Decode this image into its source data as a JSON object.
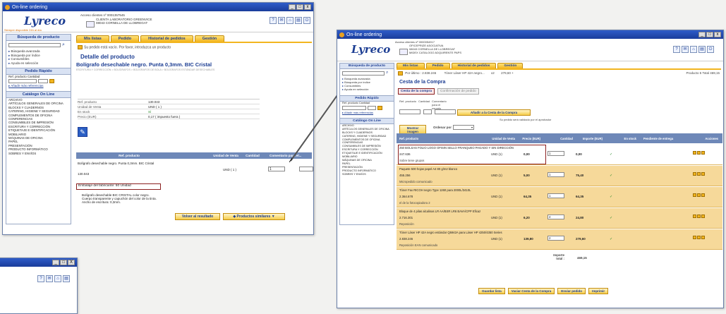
{
  "window1": {
    "title": "On-line ordering",
    "logo": "Lyreco",
    "logo_sub": "Siempre disponible 24h al día",
    "client": [
      "Acceso clientes nº 0001357545",
      "CLIENTA LABORATORIO GREENVICE",
      "08043 CORNELLA DE LLOBREGAT"
    ],
    "tabs": [
      "Mis listas",
      "Pedido",
      "Historial de pedidos",
      "Gestión"
    ],
    "empty_msg": "Su pedido está vacío. Por favor, introduzca un producto",
    "section_title": "Detalle del producto",
    "product_title": "Bolígrafo desechable negro. Punta 0,3mm. BIC Cristal",
    "breadcrumb": "ESCRITURA Y CORRECCIÓN > BOLÍGRAFOS > BOLÍGRAFOS DE BOLA > BOLÍGRAFOS ESTÁNDAR DESECHABLES",
    "details": [
      {
        "k": "Ref. producto",
        "v": "130.043"
      },
      {
        "k": "Unidad de Venta",
        "v": "UND ( 1 )"
      },
      {
        "k": "En stock",
        "v": "Sí"
      },
      {
        "k": "Precio (EUR)",
        "v": "0,17 ( impuesto fuera )"
      }
    ],
    "table_headers": [
      "Ref. producto",
      "Unidad de Venta",
      "Cantidad",
      "Comentario para el..."
    ],
    "row_desc": "Bolígrafo desechable negro. Punta 0,3mm. BIC Cristal",
    "row_ref": "130.043",
    "row_unit": "UND ( 1 )",
    "row_qty": "1",
    "packing": "Embalaje del fabricante: 50 Unidad",
    "long_desc": [
      "Bolígrafo desechable BIC CRISTAL color negro.",
      "Cuerpo transparente y capuchón del color de la tinta.",
      "Ancho de escritura: 0,3mm."
    ],
    "btn_back": "Volver al resultado",
    "btn_similar": "Productos similares",
    "sidebar": {
      "search_title": "Búsqueda de producto",
      "links": [
        "Búsqueda avanzada",
        "Búsqueda por índice",
        "Consumibles",
        "Ayuda en selección"
      ],
      "quick_title": "Pedido Rápido",
      "quick_label": "Ref. producto Cantidad",
      "more_refs": "Añadir más referencias",
      "catalog_title": "Catálogo On Line",
      "catalog": [
        "ARCHIVO",
        "ARTÍCULOS GENERALES DE OFICINA",
        "BLOCKS Y CUADERNOS",
        "CATERING, HIGIENE Y SEGURIDAD",
        "COMPLEMENTOS DE OFICINA",
        "CONFERENCIAS",
        "CONSUMIBLES DE IMPRESIÓN",
        "ESCRITURA Y CORRECCIÓN",
        "ETIQUETAJE E IDENTIFICACIÓN",
        "MOBILIARIO",
        "MÁQUINAS DE OFICINA",
        "PAPEL",
        "PRESENTACIÓN",
        "PRODUCTO INFORMÁTICO",
        "SOBRES Y ENVÍOS"
      ]
    }
  },
  "window2": {
    "title": "On-line ordering",
    "logo": "Lyreco",
    "client": [
      "Acceso clientes nº 0000054917",
      "OFICEPRIZE ASOCIATIVA",
      "08043 CORNELLA DE LLOBREGAT",
      "MIDEX CATALOGO ADQUIRENTE PAPS"
    ],
    "tabs": [
      "Mis listas",
      "Pedido",
      "Historial de pedidos",
      "Gestión"
    ],
    "last_added": "Por último : 2.838.246",
    "last_item": "Tóner Láser HP 42A negro...",
    "last_qty": "x2",
    "last_price": "279,60 +",
    "totals": "Producto 5  Total 469,15",
    "section_title": "Cesta de la Compra",
    "step1": "Cesta de la compra",
    "step2": "Confirmación de pedido",
    "quick_labels": [
      "Ref. producto",
      "Cantidad",
      "Comentario para el usuario"
    ],
    "btn_add": "Añadir a la Cesta de la Compra",
    "approver_msg": "Su pedido será validado por el aprobador",
    "btn_print": "Mostrar imagen",
    "order_by": "Ordenar por",
    "headers": [
      "Ref. producto",
      "Unidad de Venta",
      "Precio (EUR)",
      "Cantidad",
      "Importe (EUR)",
      "En stock",
      "Pendiente de entrega",
      "Acciones"
    ],
    "items": [
      {
        "desc": "250 BOLSAS FOLIO LOGO OFISIN SELLO FRANQUEO PAGADO Y SIN DIRECCIÓN",
        "ref": "247.636",
        "unit": "UND (1)",
        "price": "0,00",
        "qty": "1",
        "amount": "0,00",
        "note": "Sobre tiene grupos"
      },
      {
        "desc": "Paquete 500 hojas papel A4 80 g/m2 blanco",
        "ref": "455.256",
        "unit": "UND (1)",
        "price": "5,00",
        "qty": "1",
        "amount": "75,40",
        "note": "Micropedido comunicado"
      },
      {
        "desc": "Tóner Fax RICOH negro Type 1260 para 2000L/3410L",
        "ref": "2.364.678",
        "unit": "UND (1)",
        "price": "64,35",
        "qty": "1",
        "amount": "64,35",
        "note": "el de la fotocopiadora 2"
      },
      {
        "desc": "Bloque de 4 pilas alcalinas LR AA/BSR LR6 BAVA/CPP Eficaz",
        "ref": "2.716.301",
        "unit": "UND (1)",
        "price": "6,20",
        "qty": "4",
        "amount": "24,80",
        "note": "Reposición"
      },
      {
        "desc": "Tóner Láser HP 42A negro estándar Q5942A para Láser HP 4250/4350 Series",
        "ref": "2.838.246",
        "unit": "UND (1)",
        "price": "139,80",
        "qty": "2",
        "amount": "279,60",
        "note": "Reposición EAN comunicado"
      }
    ],
    "total_label": "Importe total :",
    "total_value": "469,15",
    "bottom_buttons": [
      "Guardar lista",
      "Vaciar Cesta de la Compra",
      "Enviar pedido",
      "Imprimir"
    ],
    "sidebar": {
      "search_title": "Búsqueda de producto",
      "links": [
        "Búsqueda avanzada",
        "Búsqueda por índice",
        "Consumibles",
        "Ayuda en selección"
      ],
      "quick_title": "Pedido Rápido",
      "quick_label": "Ref. producto Cantidad",
      "more_refs": "Añadir más referencias",
      "catalog_title": "Catálogo On Line",
      "catalog": [
        "ARCHIVO",
        "ARTÍCULOS GENERALES DE OFICINA",
        "BLOCKS Y CUADERNOS",
        "CATERING, HIGIENE Y SEGURIDAD",
        "COMPLEMENTOS DE OFICINA",
        "CONFERENCIAS",
        "CONSUMIBLES DE IMPRESIÓN",
        "ESCRITURA Y CORRECCIÓN",
        "ETIQUETAJE E IDENTIFICACIÓN",
        "MOBILIARIO",
        "MÁQUINAS DE OFICINA",
        "PAPEL",
        "PRESENTACIÓN",
        "PRODUCTO INFORMÁTICO",
        "SOBRES Y ENVÍOS"
      ]
    }
  },
  "window3": {
    "controls": [
      "_",
      "□",
      "X"
    ]
  }
}
